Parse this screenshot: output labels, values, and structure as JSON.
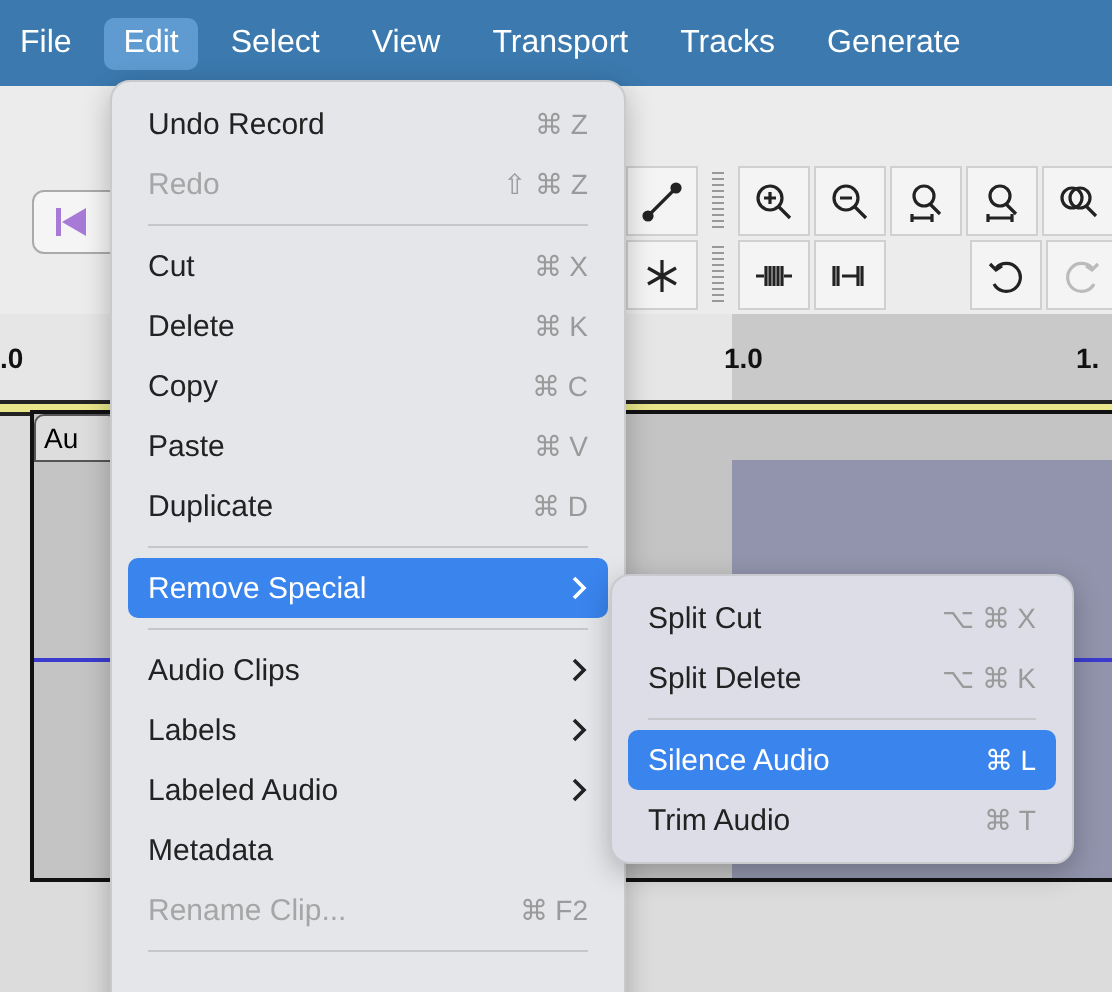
{
  "menu_bar": [
    {
      "label": "File",
      "selected": false
    },
    {
      "label": "Edit",
      "selected": true
    },
    {
      "label": "Select",
      "selected": false
    },
    {
      "label": "View",
      "selected": false
    },
    {
      "label": "Transport",
      "selected": false
    },
    {
      "label": "Tracks",
      "selected": false
    },
    {
      "label": "Generate",
      "selected": false
    }
  ],
  "ruler": {
    "labels": [
      ".0",
      "1.0",
      "1."
    ]
  },
  "track": {
    "name": "Au"
  },
  "edit_menu": {
    "items": [
      {
        "kind": "item",
        "label": "Undo Record",
        "shortcut": "⌘ Z",
        "disabled": false,
        "selected": false
      },
      {
        "kind": "item",
        "label": "Redo",
        "shortcut": "⇧ ⌘ Z",
        "disabled": true,
        "selected": false
      },
      {
        "kind": "separator"
      },
      {
        "kind": "item",
        "label": "Cut",
        "shortcut": "⌘ X",
        "disabled": false,
        "selected": false
      },
      {
        "kind": "item",
        "label": "Delete",
        "shortcut": "⌘ K",
        "disabled": false,
        "selected": false
      },
      {
        "kind": "item",
        "label": "Copy",
        "shortcut": "⌘ C",
        "disabled": false,
        "selected": false
      },
      {
        "kind": "item",
        "label": "Paste",
        "shortcut": "⌘ V",
        "disabled": false,
        "selected": false
      },
      {
        "kind": "item",
        "label": "Duplicate",
        "shortcut": "⌘ D",
        "disabled": false,
        "selected": false
      },
      {
        "kind": "separator"
      },
      {
        "kind": "submenu",
        "label": "Remove Special",
        "disabled": false,
        "selected": true
      },
      {
        "kind": "separator"
      },
      {
        "kind": "submenu",
        "label": "Audio Clips",
        "disabled": false,
        "selected": false
      },
      {
        "kind": "submenu",
        "label": "Labels",
        "disabled": false,
        "selected": false
      },
      {
        "kind": "submenu",
        "label": "Labeled Audio",
        "disabled": false,
        "selected": false
      },
      {
        "kind": "item",
        "label": "Metadata",
        "disabled": false,
        "selected": false
      },
      {
        "kind": "item",
        "label": "Rename Clip...",
        "shortcut": "⌘ F2",
        "disabled": true,
        "selected": false
      },
      {
        "kind": "separator"
      }
    ]
  },
  "submenu": {
    "items": [
      {
        "kind": "item",
        "label": "Split Cut",
        "shortcut": "⌥ ⌘ X",
        "disabled": false,
        "selected": false
      },
      {
        "kind": "item",
        "label": "Split Delete",
        "shortcut": "⌥ ⌘ K",
        "disabled": false,
        "selected": false
      },
      {
        "kind": "separator"
      },
      {
        "kind": "item",
        "label": "Silence Audio",
        "shortcut": "⌘ L",
        "disabled": false,
        "selected": true
      },
      {
        "kind": "item",
        "label": "Trim Audio",
        "shortcut": "⌘ T",
        "disabled": false,
        "selected": false
      }
    ]
  }
}
